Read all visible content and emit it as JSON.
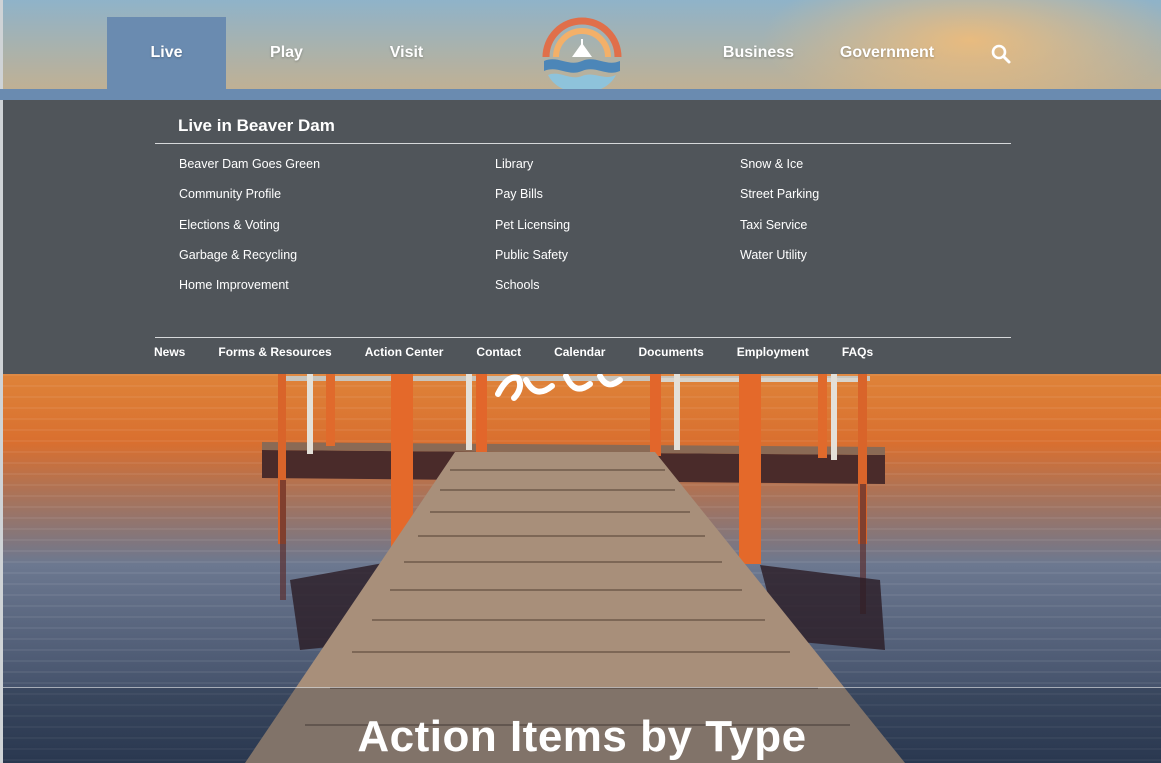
{
  "nav": {
    "items": [
      {
        "label": "Live",
        "active": true
      },
      {
        "label": "Play",
        "active": false
      },
      {
        "label": "Visit",
        "active": false
      },
      {
        "label": "Business",
        "active": false
      },
      {
        "label": "Government",
        "active": false
      }
    ],
    "search_icon": "search-icon",
    "accent_color": "#6a8bb0"
  },
  "logo": {
    "icon": "city-logo-sun-waves",
    "colors": [
      "#e06f4a",
      "#f3b069",
      "#4c86b8",
      "#8ec3db"
    ]
  },
  "mega_menu": {
    "title": "Live in Beaver Dam",
    "background": "#50555a",
    "columns": [
      [
        "Beaver Dam Goes Green",
        "Community Profile",
        "Elections & Voting",
        "Garbage & Recycling",
        "Home Improvement"
      ],
      [
        "Library",
        "Pay Bills",
        "Pet Licensing",
        "Public Safety",
        "Schools"
      ],
      [
        "Snow & Ice",
        "Street Parking",
        "Taxi Service",
        "Water Utility"
      ]
    ],
    "utility_links": [
      "News",
      "Forms & Resources",
      "Action Center",
      "Contact",
      "Calendar",
      "Documents",
      "Employment",
      "FAQs"
    ]
  },
  "hero": {
    "section_title": "Action Items by Type"
  }
}
